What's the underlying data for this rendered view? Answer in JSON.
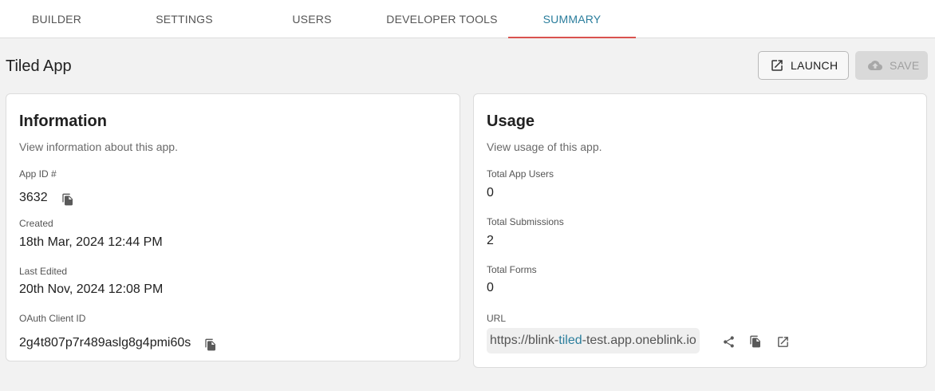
{
  "tabs": [
    {
      "label": "BUILDER",
      "active": false
    },
    {
      "label": "SETTINGS",
      "active": false
    },
    {
      "label": "USERS",
      "active": false
    },
    {
      "label": "DEVELOPER TOOLS",
      "active": false
    },
    {
      "label": "SUMMARY",
      "active": true
    }
  ],
  "header": {
    "title": "Tiled App",
    "launch_label": "LAUNCH",
    "save_label": "SAVE"
  },
  "information": {
    "title": "Information",
    "subtitle": "View information about this app.",
    "app_id_label": "App ID #",
    "app_id": "3632",
    "created_label": "Created",
    "created": "18th Mar, 2024 12:44 PM",
    "last_edited_label": "Last Edited",
    "last_edited": "20th Nov, 2024 12:08 PM",
    "oauth_label": "OAuth Client ID",
    "oauth_client_id": "2g4t807p7r489aslg8g4pmi60s"
  },
  "usage": {
    "title": "Usage",
    "subtitle": "View usage of this app.",
    "total_users_label": "Total App Users",
    "total_users": "0",
    "total_submissions_label": "Total Submissions",
    "total_submissions": "2",
    "total_forms_label": "Total Forms",
    "total_forms": "0",
    "url_label": "URL",
    "url_prefix": "https://blink-",
    "url_highlight": "tiled",
    "url_suffix": "-test.app.oneblink.io"
  },
  "icons": {
    "launch": "open-in-new-icon",
    "save": "cloud-upload-icon",
    "copy": "copy-icon",
    "share": "share-icon"
  },
  "colors": {
    "accent": "#2a7d9c",
    "tab_indicator": "#d9534f",
    "background": "#f2f2f2"
  }
}
